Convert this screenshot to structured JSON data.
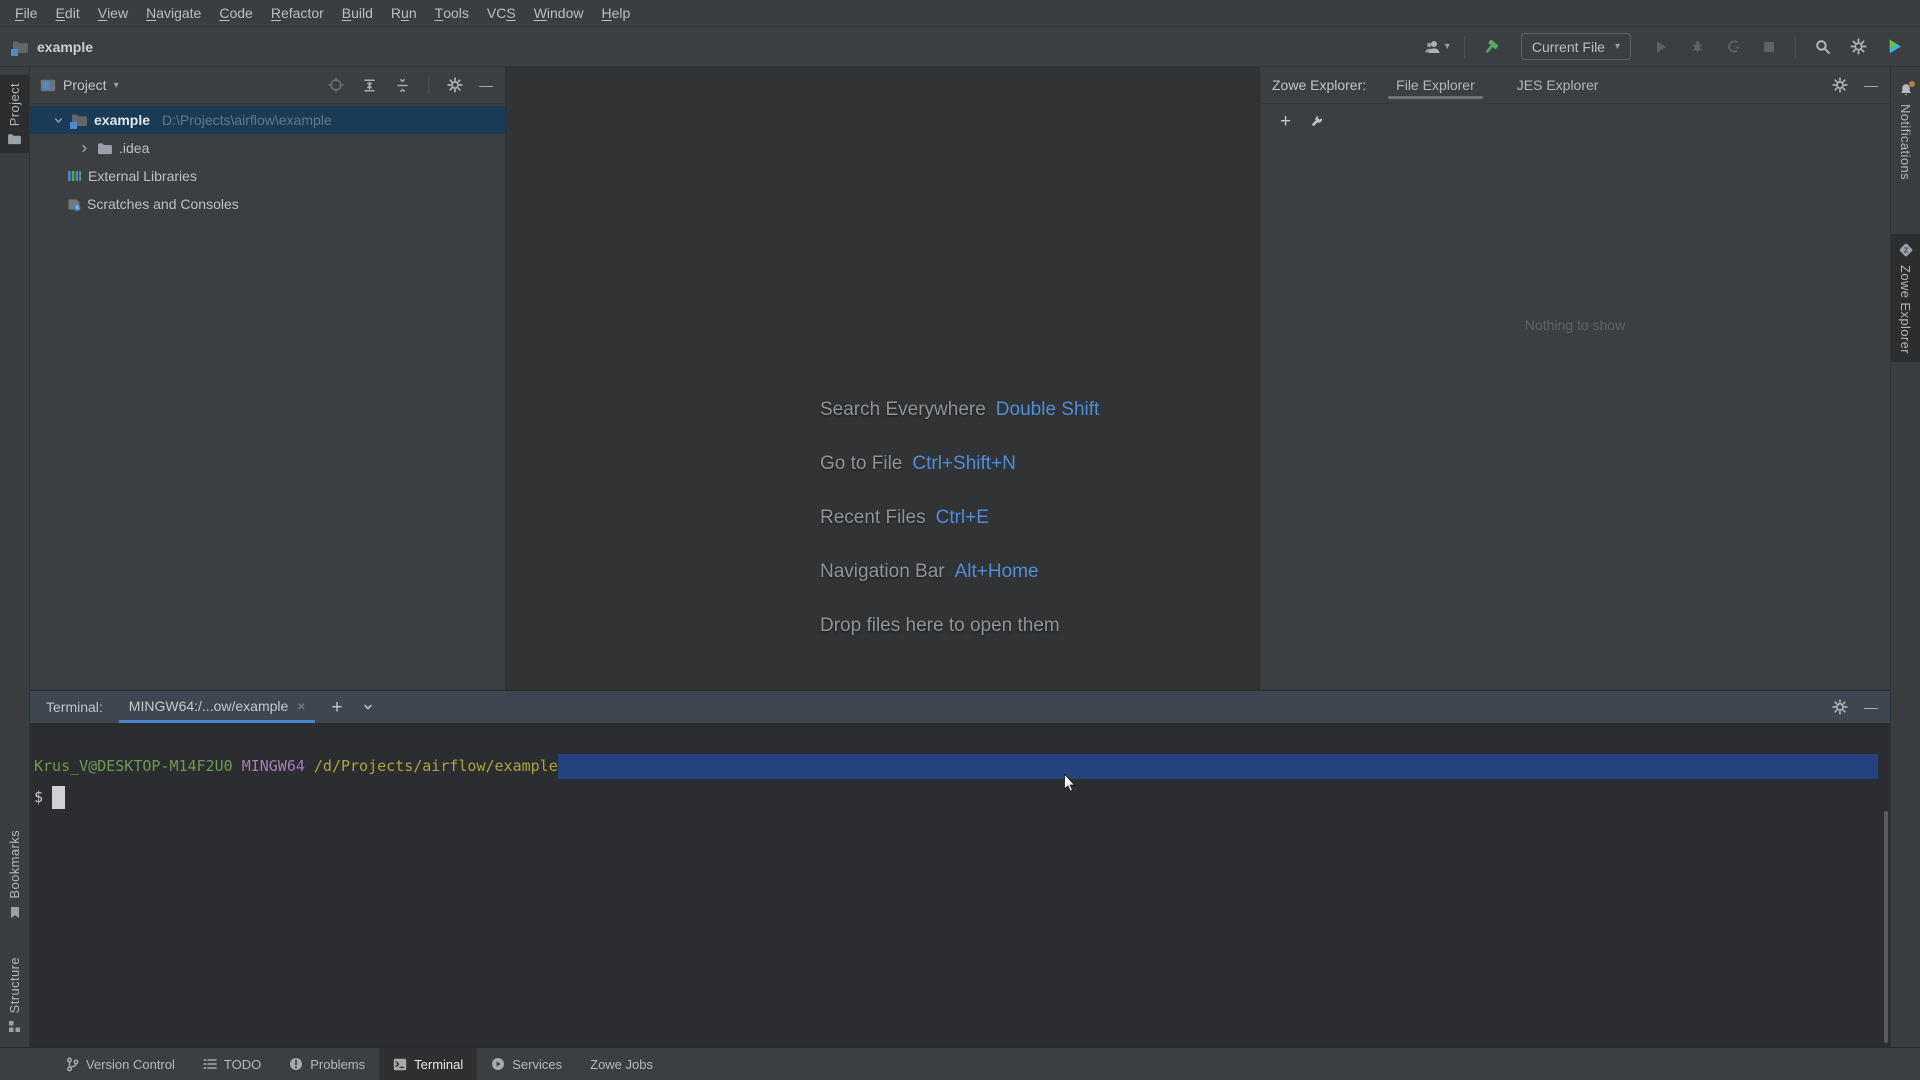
{
  "colors": {
    "accent_blue": "#4a86c8",
    "shortcut_key_blue": "#4e8ed9",
    "tree_selection": "#1a3b55",
    "terminal_selection": "#24437e",
    "terminal_user_green": "#6d9a51",
    "terminal_env_purple": "#a87db8",
    "terminal_path_yellow": "#aea43b",
    "build_hammer_green": "#59a869"
  },
  "menubar": {
    "items": [
      {
        "label": "File",
        "mnemonic": 0
      },
      {
        "label": "Edit",
        "mnemonic": 0
      },
      {
        "label": "View",
        "mnemonic": 0
      },
      {
        "label": "Navigate",
        "mnemonic": 0
      },
      {
        "label": "Code",
        "mnemonic": 0
      },
      {
        "label": "Refactor",
        "mnemonic": 0
      },
      {
        "label": "Build",
        "mnemonic": 0
      },
      {
        "label": "Run",
        "mnemonic": 1
      },
      {
        "label": "Tools",
        "mnemonic": 0
      },
      {
        "label": "VCS",
        "mnemonic": 2
      },
      {
        "label": "Window",
        "mnemonic": 0
      },
      {
        "label": "Help",
        "mnemonic": 0
      }
    ]
  },
  "titlebar": {
    "project_name": "example"
  },
  "toolbar": {
    "run_config": "Current File"
  },
  "left_stripe": {
    "buttons": [
      {
        "label": "Project",
        "active": true
      },
      {
        "label": "Bookmarks",
        "active": false
      },
      {
        "label": "Structure",
        "active": false
      }
    ]
  },
  "right_stripe": {
    "buttons": [
      {
        "label": "Notifications",
        "active": false
      },
      {
        "label": "Zowe Explorer",
        "active": true
      }
    ]
  },
  "project_panel": {
    "title": "Project",
    "tree": [
      {
        "name": "example",
        "path": "D:\\Projects\\airflow\\example",
        "selected": true,
        "expanded": true
      },
      {
        "name": ".idea",
        "collapsed": true
      },
      {
        "name": "External Libraries"
      },
      {
        "name": "Scratches and Consoles"
      }
    ]
  },
  "editor": {
    "shortcuts": [
      {
        "label": "Search Everywhere",
        "keys": "Double Shift"
      },
      {
        "label": "Go to File",
        "keys": "Ctrl+Shift+N"
      },
      {
        "label": "Recent Files",
        "keys": "Ctrl+E"
      },
      {
        "label": "Navigation Bar",
        "keys": "Alt+Home"
      },
      {
        "label": "Drop files here to open them",
        "keys": ""
      }
    ]
  },
  "zowe_panel": {
    "title": "Zowe Explorer:",
    "tabs": [
      {
        "label": "File Explorer",
        "active": true
      },
      {
        "label": "JES Explorer",
        "active": false
      }
    ],
    "empty_text": "Nothing to show"
  },
  "terminal": {
    "label": "Terminal:",
    "tab_title": "MINGW64:/...ow/example",
    "prompt": {
      "user": "Krus_V@DESKTOP-M14F2U0",
      "env": "MINGW64",
      "cwd": "/d/Projects/airflow/example"
    },
    "prompt_symbol": "$"
  },
  "statusbar": {
    "items": [
      {
        "label": "Version Control",
        "active": false
      },
      {
        "label": "TODO",
        "active": false
      },
      {
        "label": "Problems",
        "active": false
      },
      {
        "label": "Terminal",
        "active": true
      },
      {
        "label": "Services",
        "active": false
      },
      {
        "label": "Zowe Jobs",
        "active": false
      }
    ]
  },
  "glyphs": {
    "dropdown_caret": "▾",
    "minus": "—",
    "plus": "+",
    "close": "×"
  }
}
